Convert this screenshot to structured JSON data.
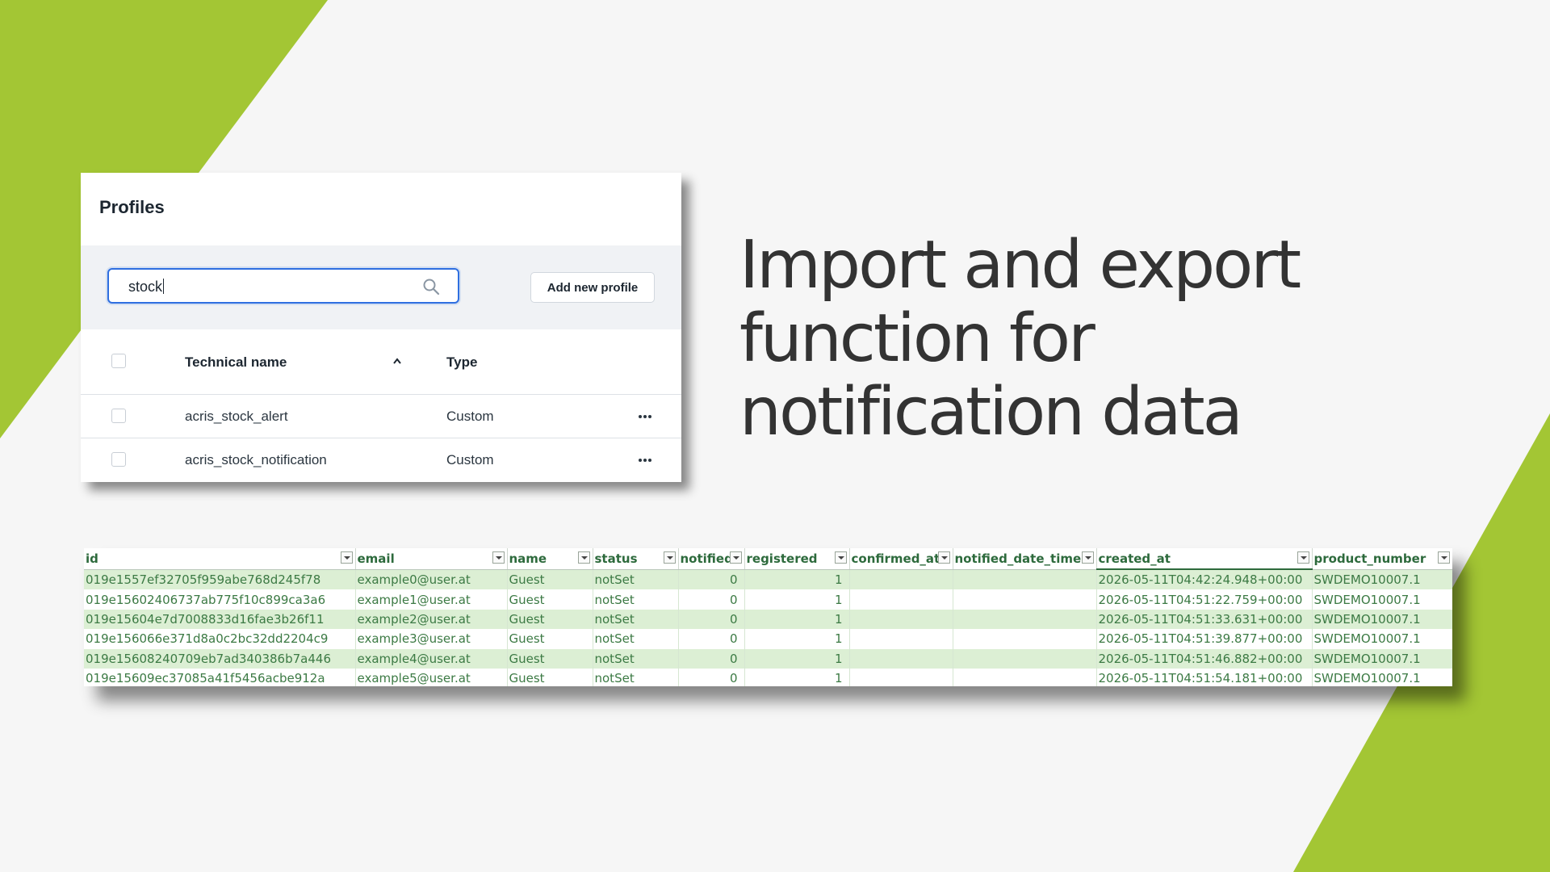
{
  "colors": {
    "accent_green": "#a3c634",
    "background": "#f6f6f6",
    "focus_blue": "#2f6fe0",
    "sheet_text_green": "#3c7a44",
    "sheet_band_green": "#dcefd4"
  },
  "profiles_panel": {
    "title": "Profiles",
    "search": {
      "value": "stock",
      "icon": "search-icon"
    },
    "add_button_label": "Add new profile",
    "columns": {
      "technical_name": "Technical name",
      "type": "Type",
      "sort_icon": "chevron-up-icon"
    },
    "rows": [
      {
        "technical_name": "acris_stock_alert",
        "type": "Custom",
        "menu_icon": "more-icon"
      },
      {
        "technical_name": "acris_stock_notification",
        "type": "Custom",
        "menu_icon": "more-icon"
      }
    ]
  },
  "headline": "Import and export function for notification data",
  "spreadsheet": {
    "headers": [
      "id",
      "email",
      "name",
      "status",
      "notified",
      "registered",
      "confirmed_at",
      "notified_date_time",
      "created_at",
      "product_number"
    ],
    "rows": [
      [
        "019e1557ef32705f959abe768d245f78",
        "example0@user.at",
        "Guest",
        "notSet",
        "0",
        "1",
        "",
        "",
        "2026-05-11T04:42:24.948+00:00",
        "SWDEMO10007.1"
      ],
      [
        "019e15602406737ab775f10c899ca3a6",
        "example1@user.at",
        "Guest",
        "notSet",
        "0",
        "1",
        "",
        "",
        "2026-05-11T04:51:22.759+00:00",
        "SWDEMO10007.1"
      ],
      [
        "019e15604e7d7008833d16fae3b26f11",
        "example2@user.at",
        "Guest",
        "notSet",
        "0",
        "1",
        "",
        "",
        "2026-05-11T04:51:33.631+00:00",
        "SWDEMO10007.1"
      ],
      [
        "019e156066e371d8a0c2bc32dd2204c9",
        "example3@user.at",
        "Guest",
        "notSet",
        "0",
        "1",
        "",
        "",
        "2026-05-11T04:51:39.877+00:00",
        "SWDEMO10007.1"
      ],
      [
        "019e15608240709eb7ad340386b7a446",
        "example4@user.at",
        "Guest",
        "notSet",
        "0",
        "1",
        "",
        "",
        "2026-05-11T04:51:46.882+00:00",
        "SWDEMO10007.1"
      ],
      [
        "019e15609ec37085a41f5456acbe912a",
        "example5@user.at",
        "Guest",
        "notSet",
        "0",
        "1",
        "",
        "",
        "2026-05-11T04:51:54.181+00:00",
        "SWDEMO10007.1"
      ]
    ]
  }
}
